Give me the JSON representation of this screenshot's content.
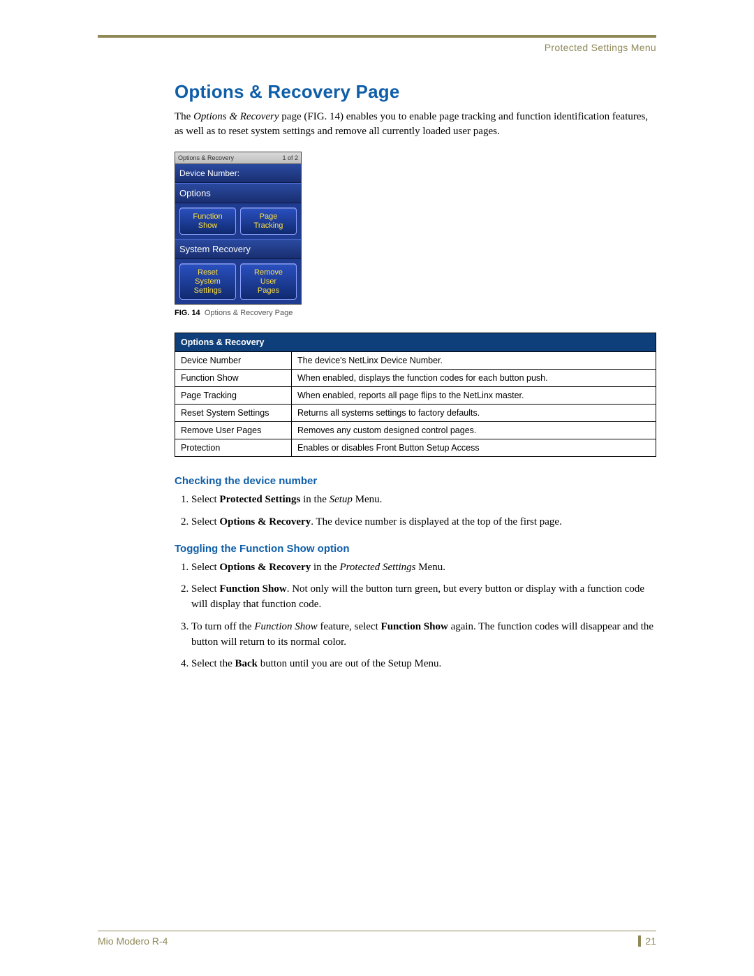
{
  "header": {
    "section": "Protected Settings Menu"
  },
  "title": "Options & Recovery Page",
  "intro": {
    "part1": "The ",
    "em1": "Options & Recovery",
    "part2": " page (FIG. 14) enables you to enable page tracking and function identification features, as well as to reset system settings and remove all currently loaded user pages."
  },
  "device": {
    "top_left": "Options & Recovery",
    "top_right": "1 of 2",
    "device_number_label": "Device Number:",
    "options_label": "Options",
    "btn_function_show_l1": "Function",
    "btn_function_show_l2": "Show",
    "btn_page_tracking_l1": "Page",
    "btn_page_tracking_l2": "Tracking",
    "system_recovery_label": "System Recovery",
    "btn_reset_l1": "Reset",
    "btn_reset_l2": "System",
    "btn_reset_l3": "Settings",
    "btn_remove_l1": "Remove",
    "btn_remove_l2": "User",
    "btn_remove_l3": "Pages"
  },
  "figure": {
    "label": "FIG. 14",
    "caption": "Options & Recovery Page"
  },
  "table": {
    "header": "Options & Recovery",
    "rows": [
      {
        "k": "Device Number",
        "v": "The device's NetLinx Device Number."
      },
      {
        "k": "Function Show",
        "v": "When enabled, displays the function codes for each button push."
      },
      {
        "k": "Page Tracking",
        "v": "When enabled, reports all page flips to the NetLinx master."
      },
      {
        "k": "Reset System Settings",
        "v": "Returns all systems settings to factory defaults."
      },
      {
        "k": "Remove User Pages",
        "v": "Removes any custom designed control pages."
      },
      {
        "k": "Protection",
        "v": "Enables or disables Front Button Setup Access"
      }
    ]
  },
  "sectionA": {
    "heading": "Checking the device number",
    "steps": [
      {
        "pre": "Select ",
        "b1": "Protected Settings",
        "mid1": " in the ",
        "i1": "Setup",
        "post": " Menu."
      },
      {
        "pre": "Select ",
        "b1": "Options & Recovery",
        "post": ". The device number is displayed at the top of the first page."
      }
    ]
  },
  "sectionB": {
    "heading": "Toggling the Function Show option",
    "steps": [
      {
        "pre": "Select ",
        "b1": "Options & Recovery",
        "mid1": " in the ",
        "i1": "Protected Settings",
        "post": " Menu."
      },
      {
        "pre": "Select ",
        "b1": "Function Show",
        "post": ". Not only will the button turn green, but every button or display with a function code will display that function code."
      },
      {
        "pre": "To turn off the ",
        "i1": "Function Show",
        "mid1": " feature, select ",
        "b1": "Function Show",
        "post": " again. The function codes will disappear and the button will return to its normal color."
      },
      {
        "pre": "Select the ",
        "b1": "Back",
        "post": " button until you are out of the Setup Menu."
      }
    ]
  },
  "footer": {
    "product": "Mio Modero R-4",
    "page": "21"
  }
}
